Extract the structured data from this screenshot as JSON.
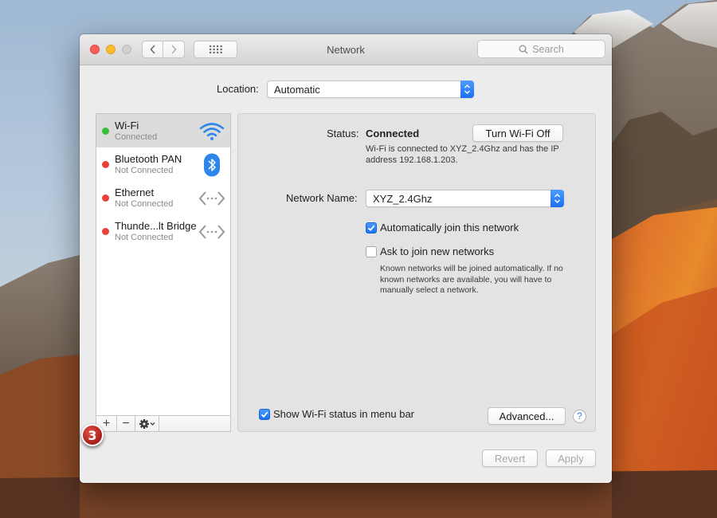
{
  "window": {
    "title": "Network",
    "search_placeholder": "Search"
  },
  "location": {
    "label": "Location:",
    "value": "Automatic"
  },
  "services": [
    {
      "name": "Wi-Fi",
      "status": "Connected",
      "color": "#3bbf3b",
      "icon": "wifi-icon",
      "selected": true
    },
    {
      "name": "Bluetooth PAN",
      "status": "Not Connected",
      "color": "#e8413c",
      "icon": "bluetooth-icon",
      "selected": false
    },
    {
      "name": "Ethernet",
      "status": "Not Connected",
      "color": "#e8413c",
      "icon": "ethernet-icon",
      "selected": false
    },
    {
      "name": "Thunde...lt Bridge",
      "status": "Not Connected",
      "color": "#e8413c",
      "icon": "ethernet-icon",
      "selected": false
    }
  ],
  "list_toolbar": {
    "add": "+",
    "remove": "−"
  },
  "badge": "3",
  "detail": {
    "status_label": "Status:",
    "status_value": "Connected",
    "turn_off_label": "Turn Wi-Fi Off",
    "status_description": "Wi-Fi is connected to XYZ_2.4Ghz and has the IP address 192.168.1.203.",
    "network_name_label": "Network Name:",
    "network_name_value": "XYZ_2.4Ghz",
    "auto_join_label": "Automatically join this network",
    "auto_join_checked": true,
    "ask_join_label": "Ask to join new networks",
    "ask_join_checked": false,
    "ask_join_description": "Known networks will be joined automatically. If no known networks are available, you will have to manually select a network.",
    "show_status_label": "Show Wi-Fi status in menu bar",
    "show_status_checked": true,
    "advanced_label": "Advanced...",
    "help_label": "?"
  },
  "footer": {
    "revert_label": "Revert",
    "apply_label": "Apply"
  },
  "colors": {
    "accent": "#1b72f3",
    "connected": "#3bbf3b",
    "disconnected": "#e8413c"
  }
}
